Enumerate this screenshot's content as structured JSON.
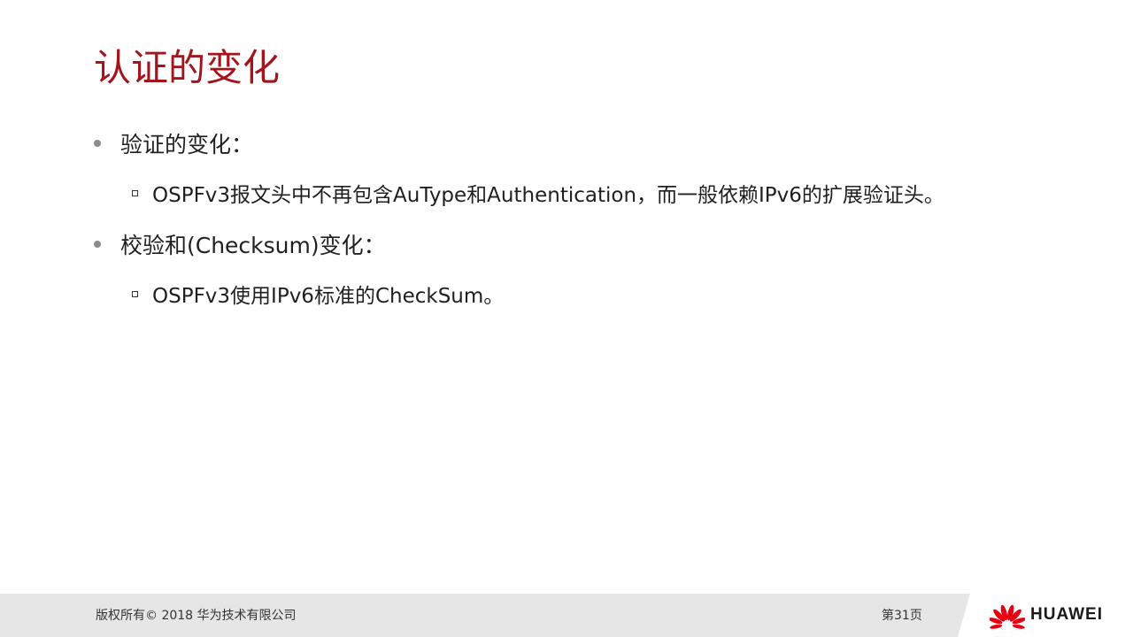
{
  "title": "认证的变化",
  "bullets": [
    {
      "text": "验证的变化：",
      "sub": [
        "OSPFv3报文头中不再包含AuType和Authentication，而一般依赖IPv6的扩展验证头。"
      ]
    },
    {
      "text": "校验和(Checksum)变化：",
      "sub": [
        "OSPFv3使用IPv6标准的CheckSum。"
      ]
    }
  ],
  "footer": {
    "copyright": "版权所有© 2018 华为技术有限公司",
    "page": "第31页",
    "brand": "HUAWEI"
  },
  "colors": {
    "title": "#a3141b",
    "brand_red": "#e60012",
    "footer_bg": "#e6e6e6"
  },
  "icons": {
    "bullet": "gray-dot-icon",
    "sub_bullet": "hollow-square-icon",
    "logo": "huawei-petal-logo-icon"
  }
}
